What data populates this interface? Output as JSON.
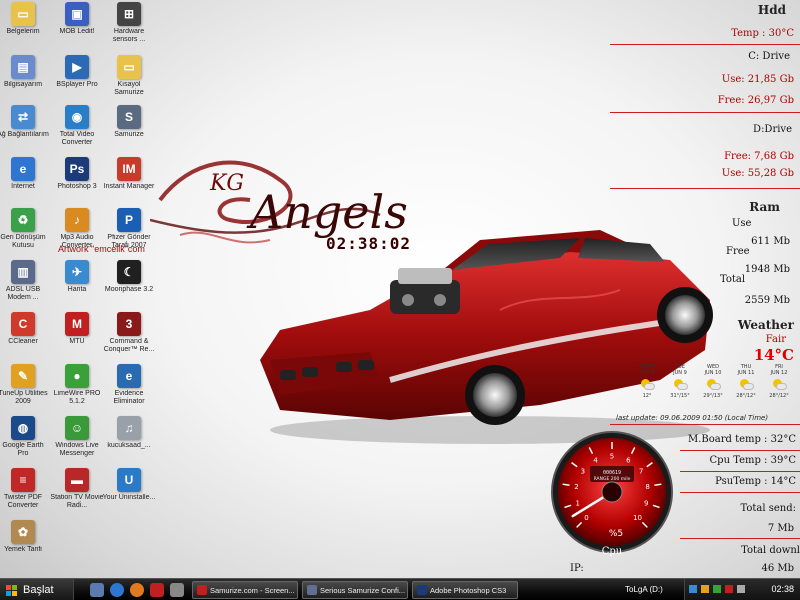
{
  "desktop": {
    "icons": [
      {
        "label": "Belgelerim",
        "icon": "folder-icon",
        "color": "#e8c24a"
      },
      {
        "label": "MOB Ledit!",
        "icon": "app-icon",
        "color": "#3a5fc0"
      },
      {
        "label": "Hardware sensors ...",
        "icon": "sensor-icon",
        "color": "#444444"
      },
      {
        "label": "Bilgisayarım",
        "icon": "computer-icon",
        "color": "#6b8ccc"
      },
      {
        "label": "BSplayer Pro",
        "icon": "player-icon",
        "color": "#2d6ab5"
      },
      {
        "label": "Kısayol Samurize",
        "icon": "folder-icon",
        "color": "#e8c24a"
      },
      {
        "label": "Ağ Bağlantılarım",
        "icon": "network-icon",
        "color": "#4a8ad0"
      },
      {
        "label": "Total Video Converter",
        "icon": "video-icon",
        "color": "#2a7ec8"
      },
      {
        "label": "Samurize",
        "icon": "samurize-icon",
        "color": "#5a6a80"
      },
      {
        "label": "Internet",
        "icon": "ie-icon",
        "color": "#2f76d2"
      },
      {
        "label": "Photoshop 3",
        "icon": "photoshop-icon",
        "color": "#1b3a78"
      },
      {
        "label": "Instant Manager",
        "icon": "im-icon",
        "color": "#c83a2a"
      },
      {
        "label": "Geri Dönüşüm Kutusu",
        "icon": "recycle-bin-icon",
        "color": "#3aa04a"
      },
      {
        "label": "Mp3 Audio Converter",
        "icon": "audio-icon",
        "color": "#d98a20"
      },
      {
        "label": "Pfizer Gönder Tarafı 2007",
        "icon": "pfizer-icon",
        "color": "#1a5fb4"
      },
      {
        "label": "ADSL USB Modem ...",
        "icon": "modem-icon",
        "color": "#5a6a8a"
      },
      {
        "label": "Harita",
        "icon": "map-icon",
        "color": "#3a8ad0"
      },
      {
        "label": "Moonphase 3.2",
        "icon": "moon-icon",
        "color": "#202020"
      },
      {
        "label": "CCleaner",
        "icon": "ccleaner-icon",
        "color": "#d03a2a"
      },
      {
        "label": "MTU",
        "icon": "mtu-icon",
        "color": "#c02020"
      },
      {
        "label": "Command & Conquer™ Re...",
        "icon": "game-icon",
        "color": "#8a1a1a"
      },
      {
        "label": "TuneUp Utilities 2009",
        "icon": "tuneup-icon",
        "color": "#e0a020"
      },
      {
        "label": "LimeWire PRO 5.1.2",
        "icon": "limewire-icon",
        "color": "#3aa03a"
      },
      {
        "label": "Evidence Eliminator",
        "icon": "evidence-icon",
        "color": "#2a6ab0"
      },
      {
        "label": "Google Earth Pro",
        "icon": "earth-icon",
        "color": "#1a4a8a"
      },
      {
        "label": "Windows Live Messenger",
        "icon": "messenger-icon",
        "color": "#3a9a3a"
      },
      {
        "label": "kucuksaad_...",
        "icon": "mp3-file-icon",
        "color": "#9aa0aa"
      },
      {
        "label": "Twister PDF Converter",
        "icon": "pdf-icon",
        "color": "#c02828"
      },
      {
        "label": "Station TV Movie Radi...",
        "icon": "tv-icon",
        "color": "#b82828"
      },
      {
        "label": "Your Uninstalle...",
        "icon": "uninstaller-icon",
        "color": "#2a7ac8"
      },
      {
        "label": "Yemek Tarifi",
        "icon": "recipe-icon",
        "color": "#b08a50"
      }
    ],
    "logo_text": "Angels",
    "logo_mark": "KG",
    "credit": "Artwork \"emcelik\"com",
    "clock": "02:38:02"
  },
  "panel": {
    "hdd_title": "Hdd",
    "hdd_temp": "Temp : 30°C",
    "c_title": "C: Drive",
    "c_use": "Use: 21,85 Gb",
    "c_free": "Free: 26,97 Gb",
    "d_title": "D:Drive",
    "d_free": "Free: 7,68 Gb",
    "d_use": "Use: 55,28 Gb",
    "ram_title": "Ram",
    "ram_use_label": "Use",
    "ram_use": "611 Mb",
    "ram_free_label": "Free",
    "ram_free": "1948 Mb",
    "ram_total_label": "Total",
    "ram_total": "2559 Mb",
    "weather_title": "Weather",
    "weather_cond": "Fair",
    "weather_temp": "14°C",
    "weather_days": [
      {
        "day": "TODAY",
        "date": "JUN 8",
        "range": "12°"
      },
      {
        "day": "TUE",
        "date": "JUN 9",
        "range": "31°/15°"
      },
      {
        "day": "WED",
        "date": "JUN 10",
        "range": "29°/13°"
      },
      {
        "day": "THU",
        "date": "JUN 11",
        "range": "28°/12°"
      },
      {
        "day": "FRI",
        "date": "JUN 12",
        "range": "28°/12°"
      }
    ],
    "weather_update": "last update: 09.06.2009 01:50 (Local Time)",
    "mboard_temp": "M.Board temp : 32°C",
    "cpu_temp": "Cpu Temp : 39°C",
    "psu_temp": "PsuTemp : 14°C",
    "total_send_label": "Total send:",
    "total_send": "7 Mb",
    "total_down_label": "Total downl",
    "total_down": "46 Mb",
    "ip_label": "IP:",
    "gauge_percent": "%5",
    "gauge_label": "Cpu",
    "gauge_value": 0.05,
    "gauge_odo": "000619",
    "gauge_range": "RANGE 200 mile",
    "gauge_ticks": [
      "0",
      "1",
      "2",
      "3",
      "4",
      "5",
      "6",
      "7",
      "8",
      "9",
      "10"
    ],
    "accent": "#c00000"
  },
  "taskbar": {
    "start_label": "Başlat",
    "tasks": [
      {
        "label": "Samurize.com - Screen...",
        "color": "#c02020"
      },
      {
        "label": "Serious Samurize Confi...",
        "color": "#607090"
      },
      {
        "label": "Adobe Photoshop CS3",
        "color": "#1b3a78"
      }
    ],
    "tray_user": "ToLgA (D:)",
    "tray_time": "02:38"
  }
}
